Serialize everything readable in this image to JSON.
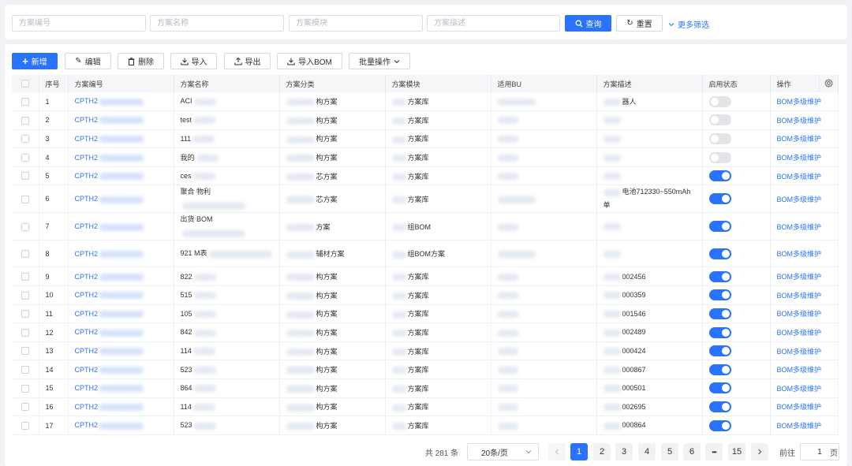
{
  "filters": {
    "code_placeholder": "方案编号",
    "name_placeholder": "方案名称",
    "module_placeholder": "方案模块",
    "desc_placeholder": "方案描述",
    "query_label": "查询",
    "reset_label": "重置",
    "more_label": "更多筛选"
  },
  "toolbar": {
    "new_label": "新增",
    "edit_label": "编辑",
    "delete_label": "删除",
    "import_label": "导入",
    "export_label": "导出",
    "import_bom_label": "导入BOM",
    "batch_label": "批量操作"
  },
  "table": {
    "headers": {
      "seq": "序号",
      "code": "方案编号",
      "name": "方案名称",
      "category": "方案分类",
      "module": "方案模块",
      "bu": "适用BU",
      "desc": "方案描述",
      "status": "启用状态",
      "action": "操作"
    },
    "rows": [
      {
        "seq": "1",
        "code": "CPTH2",
        "name": "ACI",
        "category": "构方案",
        "module": "方案库",
        "desc": "器人",
        "enabled": false,
        "action": "BOM多级维护"
      },
      {
        "seq": "2",
        "code": "CPTH2",
        "name": "test",
        "category": "构方案",
        "module": "方案库",
        "desc": "",
        "enabled": false,
        "action": "BOM多级维护"
      },
      {
        "seq": "3",
        "code": "CPTH2",
        "name": "111",
        "category": "构方案",
        "module": "方案库",
        "desc": "",
        "enabled": false,
        "action": "BOM多级维护"
      },
      {
        "seq": "4",
        "code": "CPTH2",
        "name": "我的",
        "category": "构方案",
        "module": "方案库",
        "desc": "",
        "enabled": false,
        "action": "BOM多级维护"
      },
      {
        "seq": "5",
        "code": "CPTH2",
        "name": "ces",
        "category": "芯方案",
        "module": "方案库",
        "desc": "",
        "enabled": true,
        "action": "BOM多级维护"
      },
      {
        "seq": "6",
        "code": "CPTH2",
        "name": "聚合 物利",
        "category": "芯方案",
        "module": "方案库",
        "desc": "电池712330~550mAh 单",
        "enabled": true,
        "action": "BOM多级维护"
      },
      {
        "seq": "7",
        "code": "CPTH2",
        "name": "出货 BOM",
        "category": "方案",
        "module": "组BOM",
        "desc": "",
        "enabled": true,
        "action": "BOM多级维护"
      },
      {
        "seq": "8",
        "code": "CPTH2",
        "name": "921 M表",
        "category": "辅材方案",
        "module": "组BOM方案",
        "desc": "",
        "enabled": true,
        "action": "BOM多级维护"
      },
      {
        "seq": "9",
        "code": "CPTH2",
        "name": "822",
        "category": "构方案",
        "module": "方案库",
        "desc": "002456",
        "enabled": true,
        "action": "BOM多级维护"
      },
      {
        "seq": "10",
        "code": "CPTH2",
        "name": "515",
        "category": "构方案",
        "module": "方案库",
        "desc": "000359",
        "enabled": true,
        "action": "BOM多级维护"
      },
      {
        "seq": "11",
        "code": "CPTH2",
        "name": "105",
        "category": "构方案",
        "module": "方案库",
        "desc": "001546",
        "enabled": true,
        "action": "BOM多级维护"
      },
      {
        "seq": "12",
        "code": "CPTH2",
        "name": "842",
        "category": "构方案",
        "module": "方案库",
        "desc": "002489",
        "enabled": true,
        "action": "BOM多级维护"
      },
      {
        "seq": "13",
        "code": "CPTH2",
        "name": "114",
        "category": "构方案",
        "module": "方案库",
        "desc": "000424",
        "enabled": true,
        "action": "BOM多级维护"
      },
      {
        "seq": "14",
        "code": "CPTH2",
        "name": "523",
        "category": "构方案",
        "module": "方案库",
        "desc": "000867",
        "enabled": true,
        "action": "BOM多级维护"
      },
      {
        "seq": "15",
        "code": "CPTH2",
        "name": "864",
        "category": "构方案",
        "module": "方案库",
        "desc": "000501",
        "enabled": true,
        "action": "BOM多级维护"
      },
      {
        "seq": "16",
        "code": "CPTH2",
        "name": "114",
        "category": "构方案",
        "module": "方案库",
        "desc": "002695",
        "enabled": true,
        "action": "BOM多级维护"
      },
      {
        "seq": "17",
        "code": "CPTH2",
        "name": "523",
        "category": "构方案",
        "module": "方案库",
        "desc": "000864",
        "enabled": true,
        "action": "BOM多级维护"
      }
    ]
  },
  "pagination": {
    "total_label": "共 281 条",
    "page_size": "20条/页",
    "pages": [
      "1",
      "2",
      "3",
      "4",
      "5",
      "6"
    ],
    "ellipsis": "•••",
    "last_page": "15",
    "current": "1",
    "goto_prefix": "前往",
    "goto_value": "1",
    "goto_suffix": "页"
  },
  "colors": {
    "primary": "#2a73ff",
    "background": "#f0f2f5"
  },
  "icons": [
    "search-icon",
    "refresh-icon",
    "chevron-down-icon",
    "plus-icon",
    "edit-icon",
    "trash-icon",
    "upload-icon",
    "download-icon",
    "settings-icon",
    "chevron-left-icon",
    "chevron-right-icon"
  ]
}
